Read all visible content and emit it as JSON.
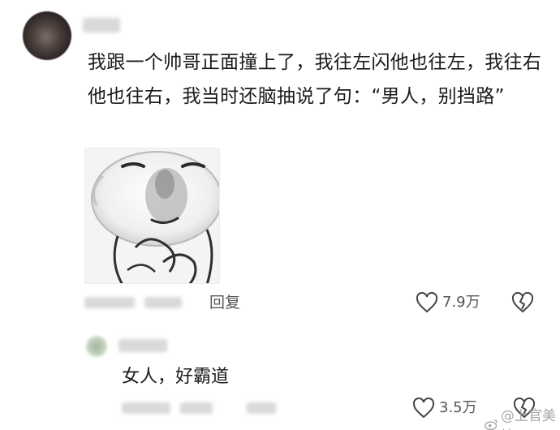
{
  "comment": {
    "text": "我跟一个帅哥正面撞上了，我往左闪他也往左，我往右他也往右，我当时还脑抽说了句：“男人，别挡路”",
    "reply_label": "回复",
    "like_count": "7.9万",
    "image_alt": "熊猫人表情包"
  },
  "reply": {
    "text": "女人，好霸道",
    "like_count": "3.5万"
  },
  "watermark": {
    "text": "@上官美娘"
  },
  "icons": {
    "like": "heart-outline-icon",
    "dislike": "broken-heart-icon",
    "watermark": "weibo-icon"
  },
  "colors": {
    "text": "#1a1a1a",
    "meta": "#555555",
    "icon": "#444444"
  }
}
